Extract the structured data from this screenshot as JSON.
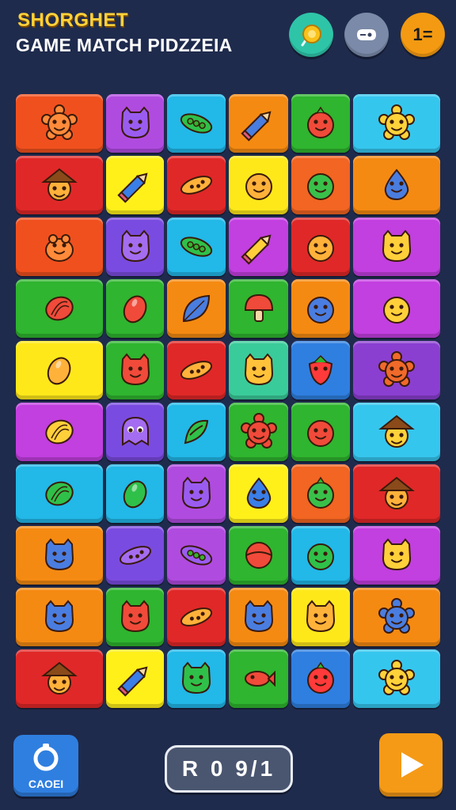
{
  "header": {
    "title_line1": "SHORGHET",
    "title_line2": "GAME MATCH PIDZZEIA",
    "button_right_label": "1="
  },
  "footer": {
    "left_button_label": "CAOEI",
    "score_text": "R 0 9/1"
  },
  "board": {
    "rows": 10,
    "cols": 6,
    "tiles": [
      [
        {
          "color": "#f0501e",
          "icon": "sun-face-icon"
        },
        {
          "color": "#b04be0",
          "icon": "cat-face-icon"
        },
        {
          "color": "#22b8e8",
          "icon": "pea-pod-icon"
        },
        {
          "color": "#f58a12",
          "icon": "pencil-icon"
        },
        {
          "color": "#2fb52f",
          "icon": "berry-face-icon"
        },
        {
          "color": "#35c6ee",
          "icon": "flower-face-icon"
        }
      ],
      [
        {
          "color": "#e02828",
          "icon": "hat-face-icon"
        },
        {
          "color": "#fff01a",
          "icon": "pencil-icon"
        },
        {
          "color": "#e02828",
          "icon": "pepper-icon"
        },
        {
          "color": "#ffe81a",
          "icon": "face-icon"
        },
        {
          "color": "#f26522",
          "icon": "face-icon"
        },
        {
          "color": "#f58a12",
          "icon": "drop-face-icon"
        }
      ],
      [
        {
          "color": "#f0501e",
          "icon": "frog-face-icon"
        },
        {
          "color": "#7a4be0",
          "icon": "cat-face-icon"
        },
        {
          "color": "#22b8e8",
          "icon": "pea-pod-icon"
        },
        {
          "color": "#c23fe0",
          "icon": "pencil-icon"
        },
        {
          "color": "#e02828",
          "icon": "face-icon"
        },
        {
          "color": "#c23fe0",
          "icon": "cat-face-icon"
        }
      ],
      [
        {
          "color": "#2fb52f",
          "icon": "shell-icon"
        },
        {
          "color": "#2fb52f",
          "icon": "egg-icon"
        },
        {
          "color": "#f58a12",
          "icon": "leaf-icon"
        },
        {
          "color": "#2fb52f",
          "icon": "mushroom-icon"
        },
        {
          "color": "#f58a12",
          "icon": "face-icon"
        },
        {
          "color": "#c23fe0",
          "icon": "face-icon"
        }
      ],
      [
        {
          "color": "#ffe81a",
          "icon": "drop-icon"
        },
        {
          "color": "#2fb52f",
          "icon": "cat-face-icon"
        },
        {
          "color": "#e02828",
          "icon": "pepper-icon"
        },
        {
          "color": "#3acb9a",
          "icon": "cat-face-icon"
        },
        {
          "color": "#2f7fe0",
          "icon": "strawberry-icon"
        },
        {
          "color": "#8a3fd0",
          "icon": "sun-face-icon"
        }
      ],
      [
        {
          "color": "#c23fe0",
          "icon": "shell-icon"
        },
        {
          "color": "#7a4be0",
          "icon": "ghost-face-icon"
        },
        {
          "color": "#22b8e8",
          "icon": "sprout-icon"
        },
        {
          "color": "#2fb52f",
          "icon": "flower-face-icon"
        },
        {
          "color": "#2fb52f",
          "icon": "face-icon"
        },
        {
          "color": "#35c6ee",
          "icon": "hat-face-icon"
        }
      ],
      [
        {
          "color": "#22b8e8",
          "icon": "shell-icon"
        },
        {
          "color": "#22b8e8",
          "icon": "drop-icon"
        },
        {
          "color": "#b04be0",
          "icon": "cat-face-icon"
        },
        {
          "color": "#fff01a",
          "icon": "drop-face-icon"
        },
        {
          "color": "#f26522",
          "icon": "berry-face-icon"
        },
        {
          "color": "#e02828",
          "icon": "hat-face-icon"
        }
      ],
      [
        {
          "color": "#f58a12",
          "icon": "cat-face-icon"
        },
        {
          "color": "#7a4be0",
          "icon": "pepper-icon"
        },
        {
          "color": "#b04be0",
          "icon": "pea-pod-icon"
        },
        {
          "color": "#2fb52f",
          "icon": "ball-icon"
        },
        {
          "color": "#22b8e8",
          "icon": "face-icon"
        },
        {
          "color": "#c23fe0",
          "icon": "cat-face-icon"
        }
      ],
      [
        {
          "color": "#f58a12",
          "icon": "cat-face-icon"
        },
        {
          "color": "#2fb52f",
          "icon": "cat-face-icon"
        },
        {
          "color": "#e02828",
          "icon": "pickle-icon"
        },
        {
          "color": "#f58a12",
          "icon": "cat-face-icon"
        },
        {
          "color": "#ffe81a",
          "icon": "cat-face-icon"
        },
        {
          "color": "#f58a12",
          "icon": "sun-face-icon"
        }
      ],
      [
        {
          "color": "#e02828",
          "icon": "hat-face-icon"
        },
        {
          "color": "#fff01a",
          "icon": "pencil-icon"
        },
        {
          "color": "#22b8e8",
          "icon": "cat-face-icon"
        },
        {
          "color": "#2fb52f",
          "icon": "fish-icon"
        },
        {
          "color": "#2f7fe0",
          "icon": "berry-face-icon"
        },
        {
          "color": "#35c6ee",
          "icon": "star-face-icon"
        }
      ]
    ]
  }
}
